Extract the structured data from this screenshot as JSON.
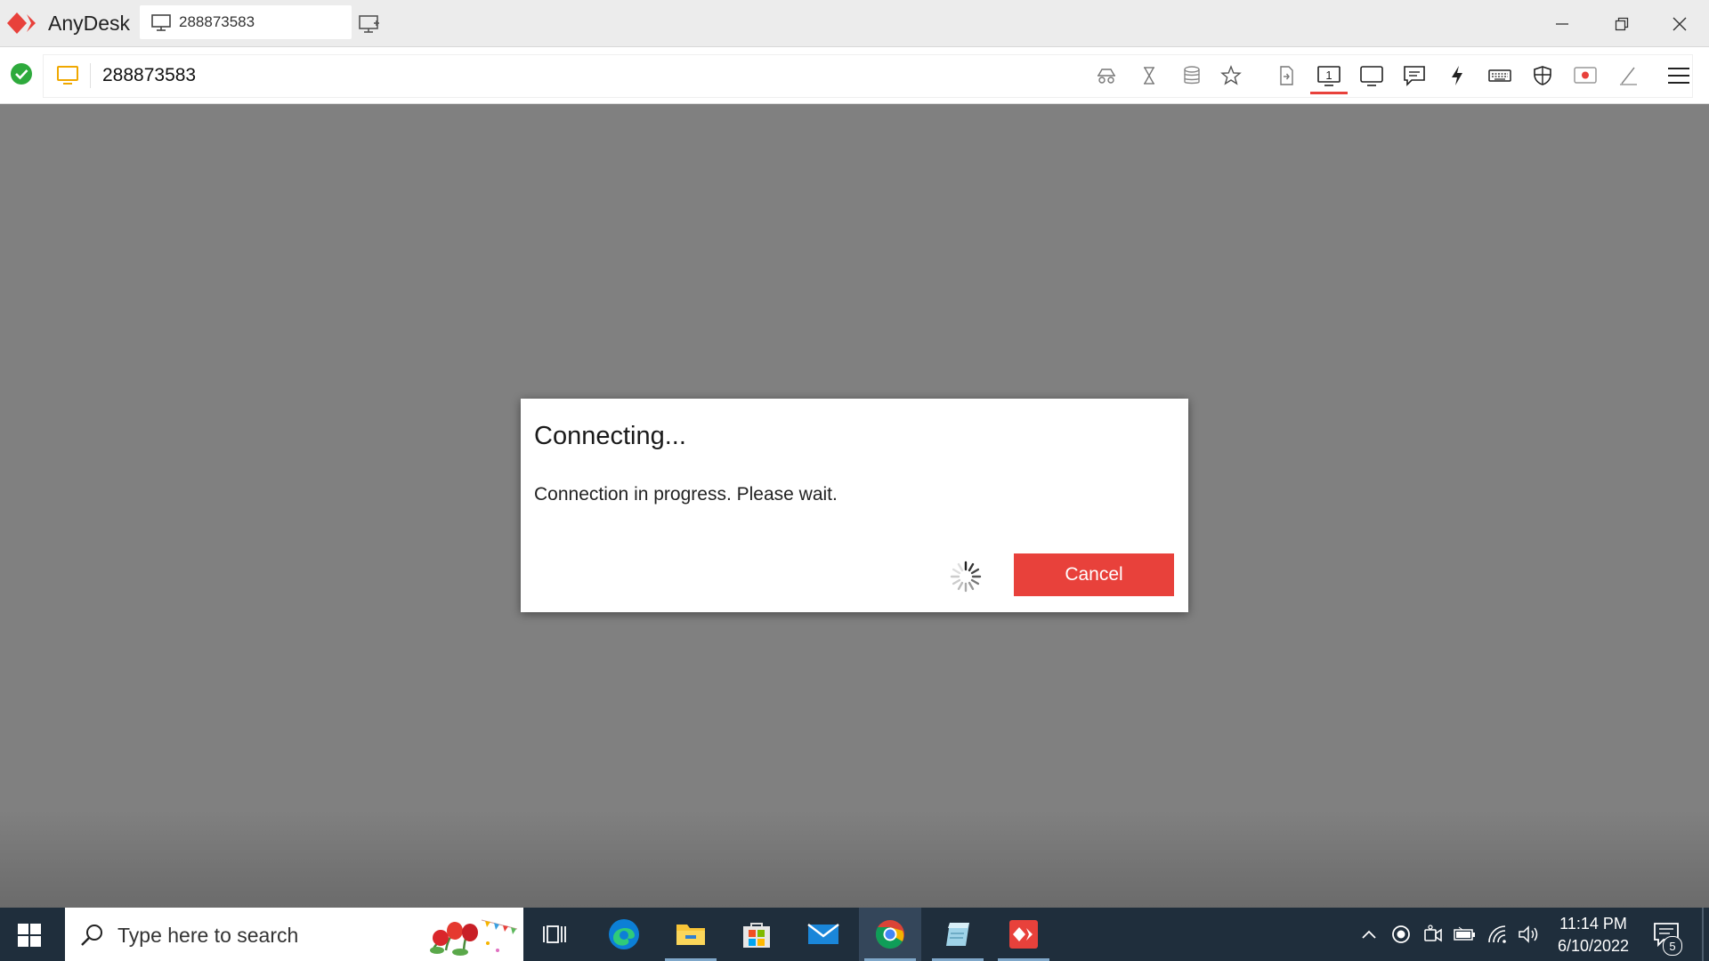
{
  "app": {
    "name": "AnyDesk",
    "tab_label": "288873583",
    "brand_color": "#e8413b"
  },
  "address_bar": {
    "value": "288873583",
    "status": "connected-ok"
  },
  "toolbar_icons": [
    "privacy-mode-icon",
    "hourglass-icon",
    "database-icon",
    "star-icon",
    "file-transfer-icon",
    "monitor-1-icon",
    "display-icon",
    "chat-icon",
    "actions-lightning-icon",
    "keyboard-icon",
    "permissions-shield-icon",
    "record-icon",
    "whiteboard-pen-icon",
    "menu-icon"
  ],
  "dialog": {
    "title": "Connecting...",
    "message": "Connection in progress. Please wait.",
    "cancel_label": "Cancel"
  },
  "taskbar": {
    "search_placeholder": "Type here to search",
    "apps": [
      "task-view",
      "edge",
      "file-explorer",
      "microsoft-store",
      "mail",
      "chrome",
      "notepad-app",
      "anydesk"
    ],
    "time": "11:14 PM",
    "date": "6/10/2022",
    "notification_count": "5"
  }
}
